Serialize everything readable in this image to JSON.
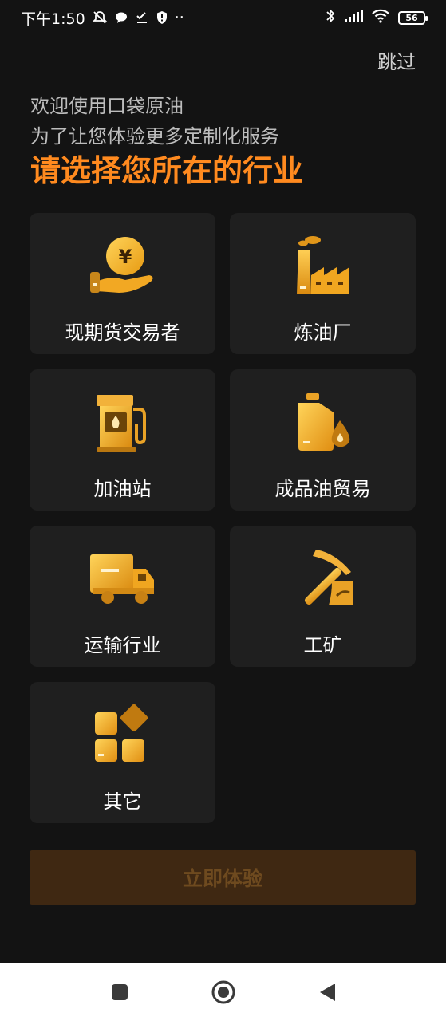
{
  "status_bar": {
    "time": "下午1:50",
    "dots": "··",
    "battery_level": "56",
    "icons": [
      "mute-icon",
      "chat-icon",
      "checklist-icon",
      "shield-icon",
      "bluetooth-icon",
      "signal-icon",
      "wifi-icon",
      "battery-icon"
    ]
  },
  "header": {
    "skip_label": "跳过",
    "welcome_line1": "欢迎使用口袋原油",
    "welcome_line2": "为了让您体验更多定制化服务",
    "headline": "请选择您所在的行业"
  },
  "industries": [
    {
      "label": "现期货交易者",
      "icon": "coin-hand-icon"
    },
    {
      "label": "炼油厂",
      "icon": "factory-icon"
    },
    {
      "label": "加油站",
      "icon": "fuel-pump-icon"
    },
    {
      "label": "成品油贸易",
      "icon": "oil-can-icon"
    },
    {
      "label": "运输行业",
      "icon": "truck-icon"
    },
    {
      "label": "工矿",
      "icon": "pickaxe-icon"
    },
    {
      "label": "其它",
      "icon": "blocks-icon"
    }
  ],
  "cta": {
    "label": "立即体验"
  },
  "nav": {
    "icons": [
      "recent-apps-icon",
      "home-icon",
      "back-icon"
    ]
  },
  "colors": {
    "background": "#131313",
    "card": "#1f1f1f",
    "accent": "#ff8a1f",
    "icon_gold": "#f0b232",
    "cta_bg": "#3f2812",
    "cta_text": "#6e4a1f"
  }
}
